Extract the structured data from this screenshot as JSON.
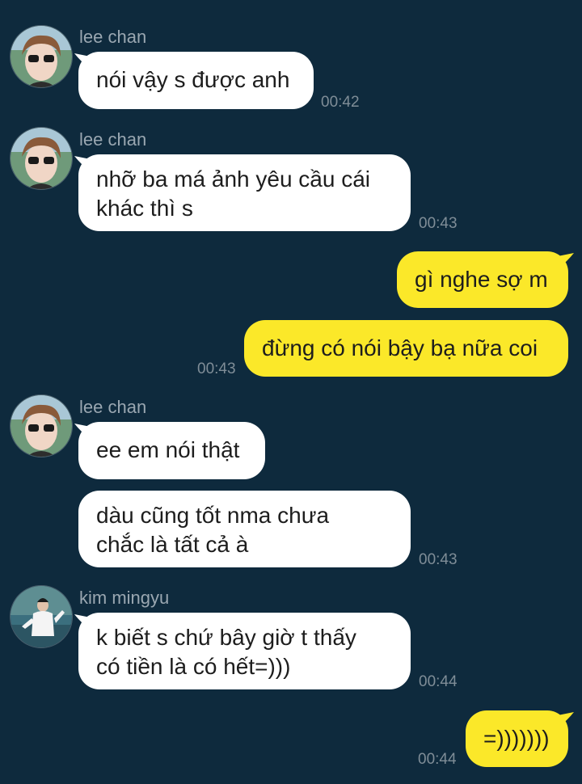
{
  "colors": {
    "background": "#0e2a3d",
    "incoming_bubble": "#ffffff",
    "outgoing_bubble": "#fbe829",
    "meta_text": "#9aa7b1"
  },
  "messages": [
    {
      "sender": "lee chan",
      "text_lines": [
        "nói vậy s được anh"
      ],
      "time": "00:42"
    },
    {
      "sender": "lee chan",
      "text_lines": [
        "nhỡ ba má ảnh yêu cầu cái",
        "khác thì s"
      ],
      "time": "00:43"
    },
    {
      "sender": "me",
      "text_lines": [
        "gì nghe sợ m"
      ],
      "time": ""
    },
    {
      "sender": "me",
      "text_lines": [
        "đừng có nói bậy bạ nữa coi"
      ],
      "time": "00:43"
    },
    {
      "sender": "lee chan",
      "text_lines": [
        "ee em nói thật"
      ],
      "time": ""
    },
    {
      "sender": "lee chan",
      "text_lines": [
        "dàu cũng tốt nma chưa",
        "chắc là tất cả à"
      ],
      "time": "00:43"
    },
    {
      "sender": "kim mingyu",
      "text_lines": [
        "k biết s chứ bây giờ t thấy",
        "có tiền là có hết=)))"
      ],
      "time": "00:44"
    },
    {
      "sender": "me",
      "text_lines": [
        "=)))))))"
      ],
      "time": "00:44"
    }
  ]
}
